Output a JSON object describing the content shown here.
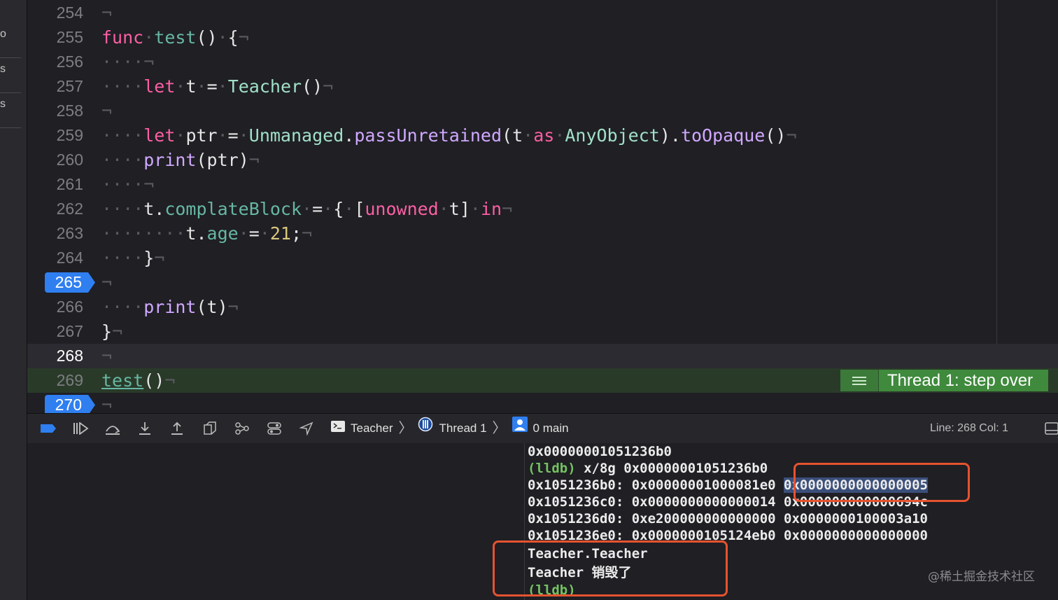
{
  "sidebar": {
    "fragments": [
      "o",
      "s",
      "s"
    ]
  },
  "editor": {
    "lines": [
      {
        "num": "254"
      },
      {
        "num": "255"
      },
      {
        "num": "256"
      },
      {
        "num": "257"
      },
      {
        "num": "258"
      },
      {
        "num": "259"
      },
      {
        "num": "260"
      },
      {
        "num": "261"
      },
      {
        "num": "262"
      },
      {
        "num": "263"
      },
      {
        "num": "264"
      },
      {
        "num": "265",
        "breakpoint": true
      },
      {
        "num": "266"
      },
      {
        "num": "267"
      },
      {
        "num": "268",
        "current": true
      },
      {
        "num": "269",
        "stepped": true
      },
      {
        "num": "270",
        "breakpoint": true
      }
    ],
    "step_badge": "Thread 1: step over"
  },
  "debug_bar": {
    "target": "Teacher",
    "thread": "Thread 1",
    "frame": "0 main",
    "line_col": "Line: 268  Col: 1"
  },
  "console": {
    "lines": [
      "0x00000001051236b0",
      "(lldb) x/8g 0x00000001051236b0",
      "0x1051236b0: 0x00000001000081e0 0x0000000000000005",
      "0x1051236c0: 0x0000000000000014 0x000000000000694c",
      "0x1051236d0: 0xe200000000000000 0x0000000100003a10",
      "0x1051236e0: 0x0000000105124eb0 0x0000000000000000",
      "Teacher.Teacher",
      "Teacher 销毁了",
      "(lldb)"
    ],
    "cmd_prompt": "(lldb)",
    "cmd_text": " x/8g 0x00000001051236b0",
    "row0_addr": "0x1051236b0: 0x00000001000081e0 ",
    "row0_selected": "0x0000000000000005"
  },
  "watermark": "@稀土掘金技术社区",
  "colors": {
    "keyword": "#fc5fa3",
    "function": "#67b7a4",
    "type": "#d0a8ff",
    "number": "#d9c97c",
    "breakpoint": "#2f7ff0",
    "step_badge": "#3f8a3d",
    "lldb_prompt": "#74c162",
    "highlight_box": "#e5532f"
  }
}
